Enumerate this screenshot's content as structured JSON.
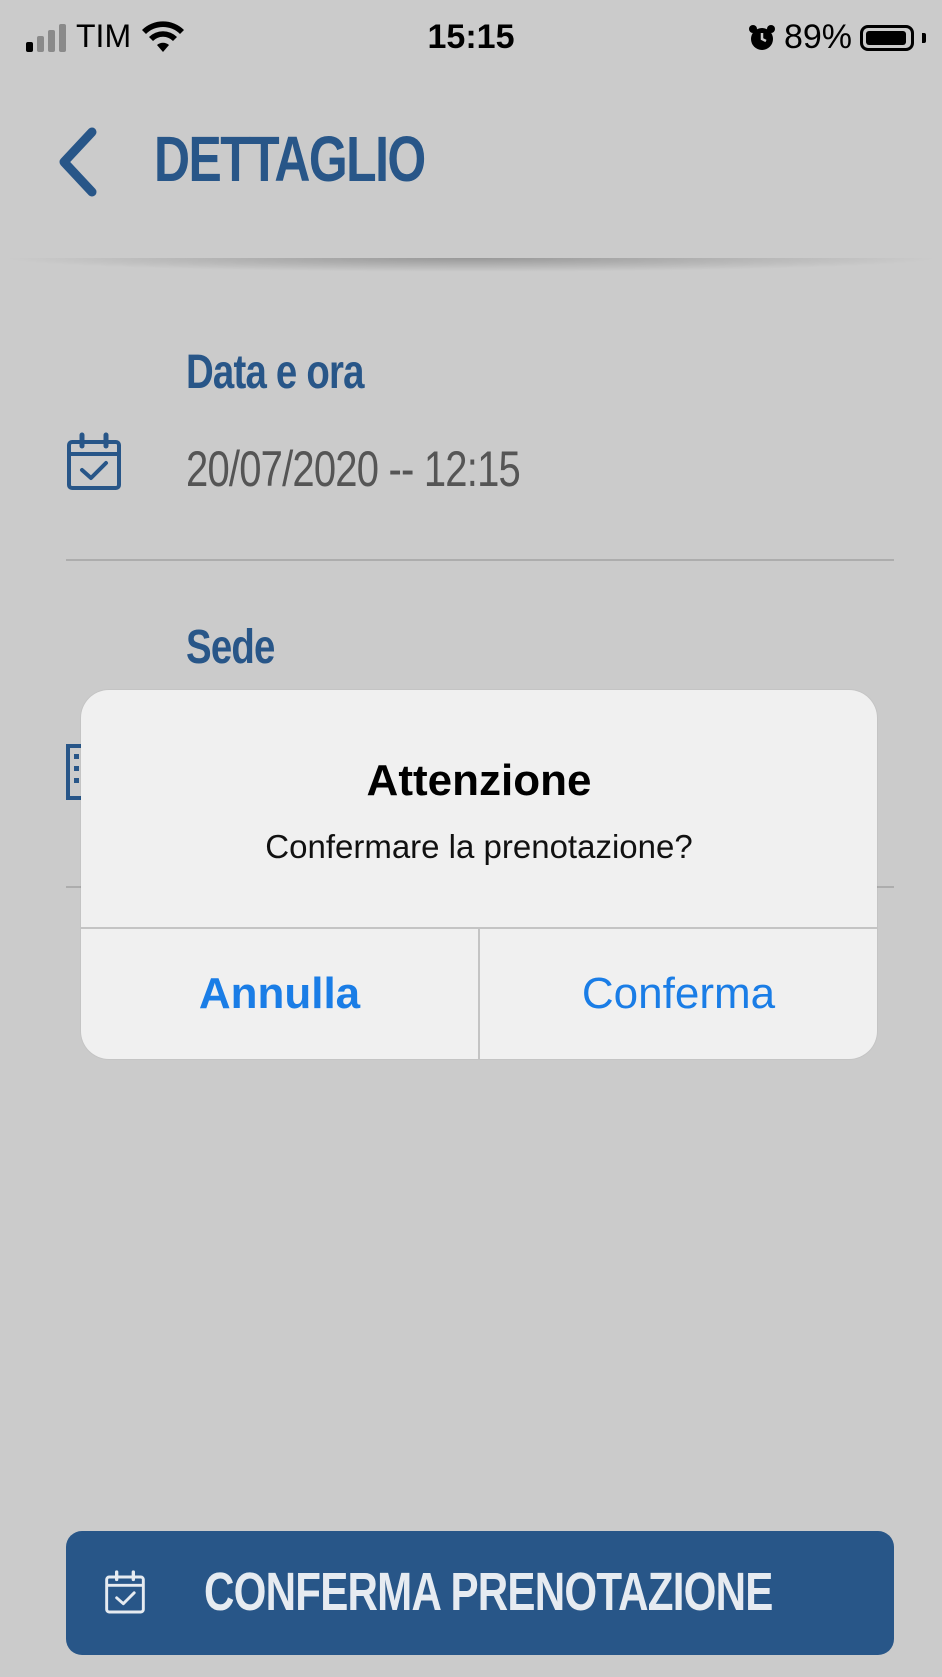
{
  "status_bar": {
    "carrier": "TIM",
    "time": "15:15",
    "battery_percent": "89%"
  },
  "header": {
    "title": "DETTAGLIO",
    "back_icon": "chevron-left-icon"
  },
  "sections": {
    "date": {
      "title": "Data e ora",
      "value": "20/07/2020 -- 12:15",
      "icon": "calendar-check-icon"
    },
    "location": {
      "title": "Sede",
      "icon": "building-icon"
    }
  },
  "alert": {
    "title": "Attenzione",
    "message": "Confermare la prenotazione?",
    "cancel_label": "Annulla",
    "confirm_label": "Conferma"
  },
  "bottom_button": {
    "label": "CONFERMA PRENOTAZIONE",
    "icon": "calendar-check-icon"
  },
  "colors": {
    "primary": "#285688",
    "ios_blue": "#1a7de6",
    "background_dimmed": "#cbcbcb"
  }
}
